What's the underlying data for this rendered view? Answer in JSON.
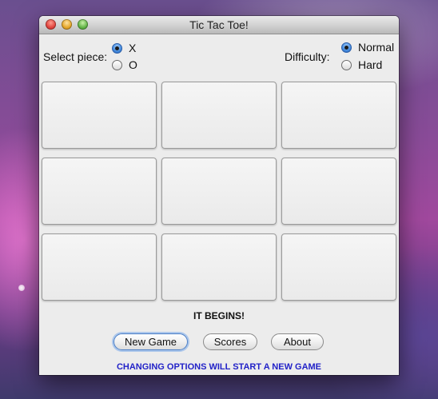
{
  "window": {
    "title": "Tic Tac Toe!"
  },
  "options": {
    "piece_label": "Select piece:",
    "piece_options": [
      {
        "label": "X",
        "selected": true
      },
      {
        "label": "O",
        "selected": false
      }
    ],
    "difficulty_label": "Difficulty:",
    "difficulty_options": [
      {
        "label": "Normal",
        "selected": true
      },
      {
        "label": "Hard",
        "selected": false
      }
    ]
  },
  "board": {
    "cells": [
      "",
      "",
      "",
      "",
      "",
      "",
      "",
      "",
      ""
    ]
  },
  "status": "IT BEGINS!",
  "buttons": {
    "new_game": "New Game",
    "scores": "Scores",
    "about": "About"
  },
  "footer_note": "CHANGING OPTIONS WILL START A NEW GAME",
  "colors": {
    "footer_text": "#2222c8",
    "radio_selected": "#4a8fe0"
  }
}
